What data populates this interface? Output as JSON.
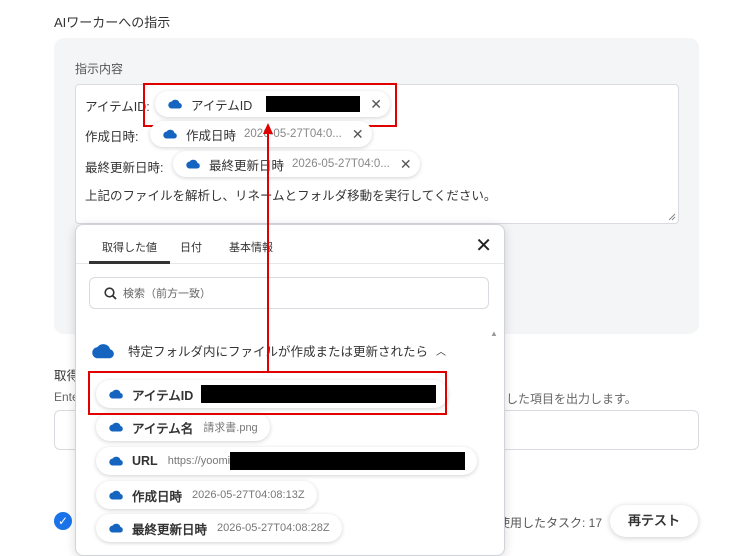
{
  "section_title": "AIワーカーへの指示",
  "field_label": "指示内容",
  "rows": [
    {
      "label": "アイテムID:",
      "chip_name": "アイテムID",
      "chip_value": ""
    },
    {
      "label": "作成日時:",
      "chip_name": "作成日時",
      "chip_value": "2026-05-27T04:0..."
    },
    {
      "label": "最終更新日時:",
      "chip_name": "最終更新日時",
      "chip_value": "2026-05-27T04:0..."
    }
  ],
  "instruction_text": "上記のファイルを解析し、リネームとフォルダ移動を実行してください。",
  "background": {
    "label_fragment": "取得",
    "enter_fragment": "Ente",
    "right_text": "した項目を出力します。",
    "task_text": "使用したタスク: 17",
    "retest_button": "再テスト"
  },
  "popup": {
    "tabs": [
      "取得した値",
      "日付",
      "基本情報"
    ],
    "close_icon": "close-icon",
    "search_placeholder": "検索（前方一致）",
    "group_title": "特定フォルダ内にファイルが作成または更新されたら",
    "items": [
      {
        "name": "アイテムID",
        "value": ""
      },
      {
        "name": "アイテム名",
        "value": "請求書.png"
      },
      {
        "name": "URL",
        "value": "https://yoomi"
      },
      {
        "name": "作成日時",
        "value": "2026-05-27T04:08:13Z"
      },
      {
        "name": "最終更新日時",
        "value": "2026-05-27T04:08:28Z"
      }
    ]
  },
  "colors": {
    "accent": "#1a73e8",
    "highlight": "#e00000",
    "cloud": "#1565c0"
  }
}
